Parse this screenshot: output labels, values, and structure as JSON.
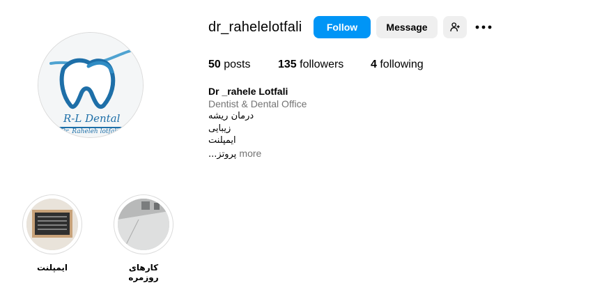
{
  "profile": {
    "username": "dr_rahelelotfali",
    "avatar_logo": {
      "brand": "R-L Dental",
      "doctor": "Dr. Raheleh lotfali"
    },
    "buttons": {
      "follow": "Follow",
      "message": "Message",
      "add_user_icon": "person-add-icon",
      "more_icon": "more-horizontal-icon"
    },
    "stats": {
      "posts_count": "50",
      "posts_label": "posts",
      "followers_count": "135",
      "followers_label": "followers",
      "following_count": "4",
      "following_label": "following"
    },
    "bio": {
      "name": "Dr _rahele Lotfali",
      "category": "Dentist & Dental Office",
      "lines": [
        "درمان ریشه",
        "زیبایی",
        "ایمپلنت",
        "پروتز..."
      ],
      "more": "more"
    }
  },
  "highlights": [
    {
      "label": "ایمپلنت"
    },
    {
      "label": "کارهای روزمره"
    }
  ],
  "colors": {
    "accent": "#0095f6",
    "logo_blue": "#1e6fa8",
    "secondary_button": "#efefef",
    "muted_text": "#737373"
  }
}
